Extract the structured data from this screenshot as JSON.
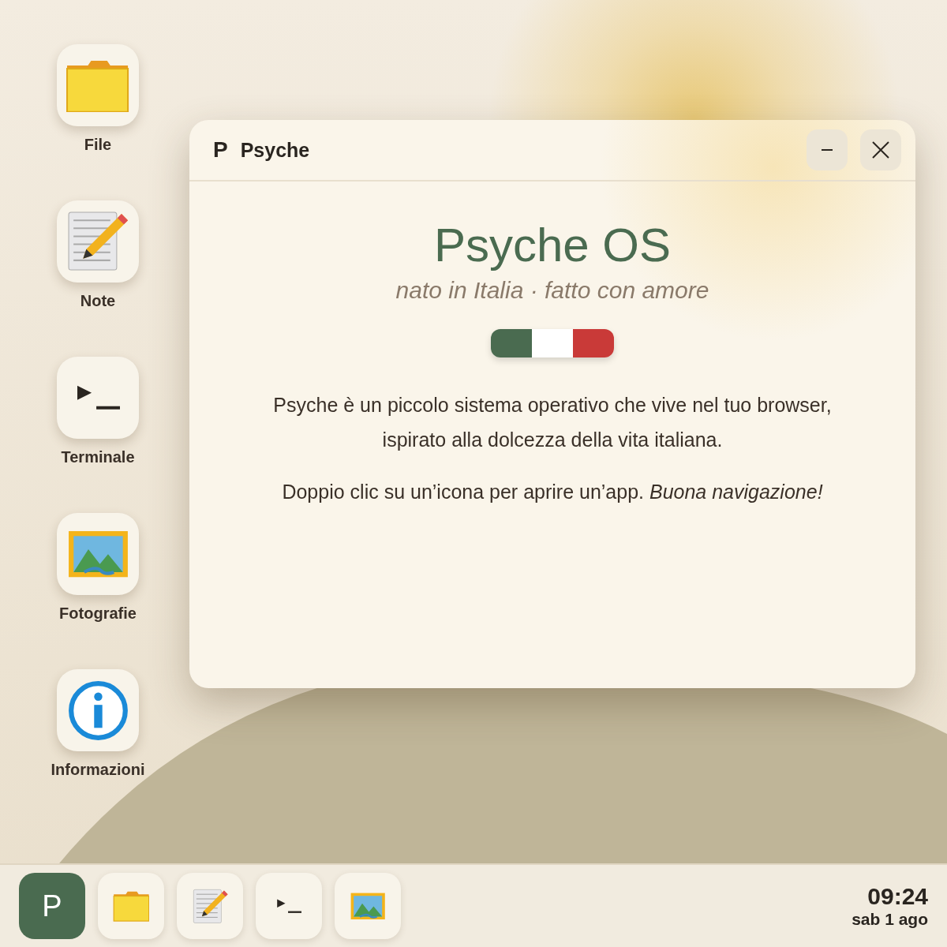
{
  "desktop_icons": [
    {
      "kind": "folder",
      "label": "File"
    },
    {
      "kind": "notes",
      "label": "Note"
    },
    {
      "kind": "terminal",
      "label": "Terminale"
    },
    {
      "kind": "photos",
      "label": "Fotografie"
    },
    {
      "kind": "info",
      "label": "Informazioni"
    }
  ],
  "window": {
    "logo": "P",
    "title": "Psyche",
    "heading": "Psyche OS",
    "tagline": "nato in Italia · fatto con amore",
    "flag": [
      {
        "color": "#4a6b50"
      },
      {
        "color": "#ffffff"
      },
      {
        "color": "#c93a38"
      }
    ],
    "paragraphs": [
      "Psyche è un piccolo sistema operativo che vive nel tuo browser, ispirato alla dolcezza della vita italiana.",
      "Doppio clic su un’icona per aprire un’app. *Buona navigazione!*"
    ]
  },
  "taskbar": {
    "start": "P",
    "apps": [
      {
        "kind": "folder"
      },
      {
        "kind": "notes"
      },
      {
        "kind": "terminal"
      },
      {
        "kind": "photos"
      }
    ],
    "time": "09:24",
    "date": "sab 1 ago"
  }
}
